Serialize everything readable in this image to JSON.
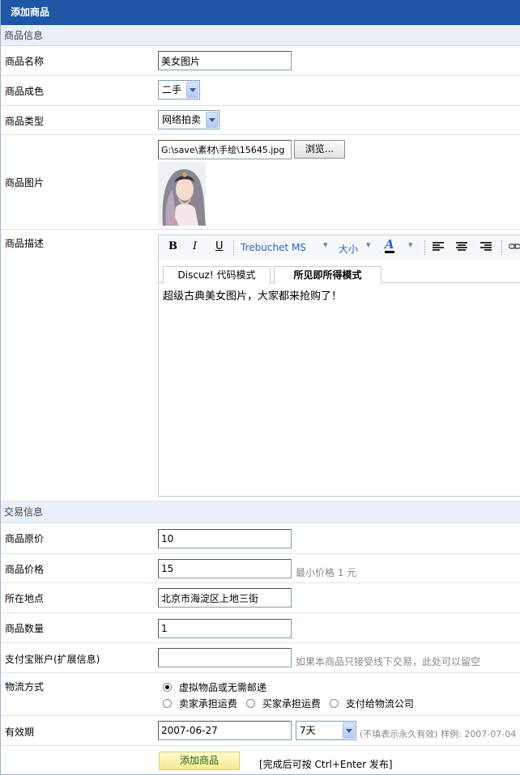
{
  "title": "添加商品",
  "sections": {
    "goods_info": "商品信息",
    "trade_info": "交易信息"
  },
  "fields": {
    "name": {
      "label": "商品名称",
      "value": "美女图片"
    },
    "condition": {
      "label": "商品成色",
      "selected": "二手"
    },
    "type": {
      "label": "商品类型",
      "selected": "网络拍卖"
    },
    "image": {
      "label": "商品图片",
      "value": "G:\\save\\素材\\手绘\\15645.jpg",
      "browse": "浏览..."
    },
    "description": {
      "label": "商品描述"
    },
    "orig_price": {
      "label": "商品原价",
      "value": "10"
    },
    "price": {
      "label": "商品价格",
      "value": "15",
      "hint": "最小价格 1 元"
    },
    "location": {
      "label": "所在地点",
      "value": "北京市海淀区上地三街"
    },
    "quantity": {
      "label": "商品数量",
      "value": "1"
    },
    "alipay": {
      "label": "支付宝账户(扩展信息)",
      "value": "",
      "hint": "如果本商品只接受线下交易，此处可以留空"
    },
    "shipping": {
      "label": "物流方式",
      "options": [
        "虚拟物品或无需邮递",
        "卖家承担运费",
        "买家承担运费",
        "支付给物流公司"
      ],
      "selected_index": 0
    },
    "expiry": {
      "label": "有效期",
      "value": "2007-06-27",
      "days": "7天",
      "hint": "(不填表示永久有效) 样例: 2007-07-04"
    }
  },
  "editor": {
    "font_name": "Trebuchet MS",
    "size": "大小",
    "bold": "B",
    "italic": "I",
    "underline": "U",
    "font_color_glyph": "A",
    "tabs": [
      "Discuz! 代码模式",
      "所见即所得模式"
    ],
    "active_tab": 1,
    "content": "超级古典美女图片，大家都来抢购了！"
  },
  "submit": {
    "label": "添加商品",
    "shortcut_hint": "[完成后可按 Ctrl+Enter 发布]"
  },
  "colors": {
    "title_bg": "#1f57a6",
    "section_bg": "#e8f0fa",
    "link_blue": "#2a62c9",
    "submit_text": "#21650f"
  }
}
